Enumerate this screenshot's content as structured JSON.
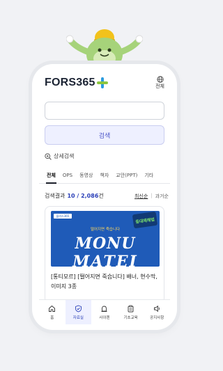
{
  "header": {
    "logo_text": "FORS365",
    "language_label": "전체",
    "icons": [
      "plus-logo-icon",
      "globe-icon"
    ]
  },
  "search": {
    "input_value": "",
    "button_label": "검색",
    "detail_label": "상세검색"
  },
  "tabs": [
    {
      "label": "전체",
      "active": true
    },
    {
      "label": "OPS",
      "active": false
    },
    {
      "label": "동영상",
      "active": false
    },
    {
      "label": "책자",
      "active": false
    },
    {
      "label": "교안(PPT)",
      "active": false
    },
    {
      "label": "기타",
      "active": false
    }
  ],
  "results": {
    "prefix": "검색결과",
    "count": "10 / 2,086",
    "suffix": "건",
    "sort_latest": "최신순",
    "sort_oldest": "과거순"
  },
  "card": {
    "thumb_brand": "플러스365",
    "thumb_badge": "중대재해법",
    "thumb_sub": "떨어지면 죽습니다",
    "thumb_title_1": "MONU",
    "thumb_title_2": "MATEI",
    "title": "[통티모르] [떨어지면 죽습니다] 배너, 현수막, 이미지 3종"
  },
  "bottom_nav": [
    {
      "label": "홈",
      "icon": "home-icon",
      "active": false
    },
    {
      "label": "자료실",
      "icon": "shield-check-icon",
      "active": true
    },
    {
      "label": "사이렌",
      "icon": "siren-icon",
      "active": false
    },
    {
      "label": "기초교육",
      "icon": "clipboard-icon",
      "active": false
    },
    {
      "label": "공지사항",
      "icon": "speaker-icon",
      "active": false
    }
  ],
  "colors": {
    "accent": "#2a3fb8",
    "logo_plus_blue": "#2a9be0",
    "logo_plus_green": "#8cc63f",
    "mascot": "#a6d37a"
  }
}
